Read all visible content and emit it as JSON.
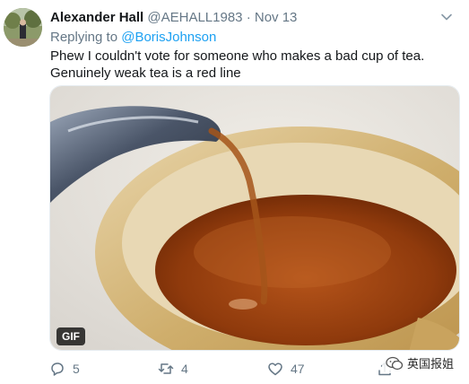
{
  "tweet": {
    "author_name": "Alexander Hall",
    "handle": "@AEHALL1983",
    "separator": "·",
    "date": "Nov 13",
    "replying_prefix": "Replying to",
    "replying_to": "@BorisJohnson",
    "text_line1": "Phew I couldn't vote for someone who makes a bad cup of tea.",
    "text_line2": "Genuinely weak tea is a red line",
    "media_badge": "GIF"
  },
  "actions": {
    "replies": "5",
    "retweets": "4",
    "likes": "47"
  },
  "watermark": {
    "text": "英国报姐"
  },
  "colors": {
    "link": "#1da1f2",
    "secondary_text": "#657786",
    "primary_text": "#14171a"
  },
  "icons": [
    "chevron-down-icon",
    "reply-icon",
    "retweet-icon",
    "like-icon",
    "share-icon",
    "wechat-icon"
  ]
}
